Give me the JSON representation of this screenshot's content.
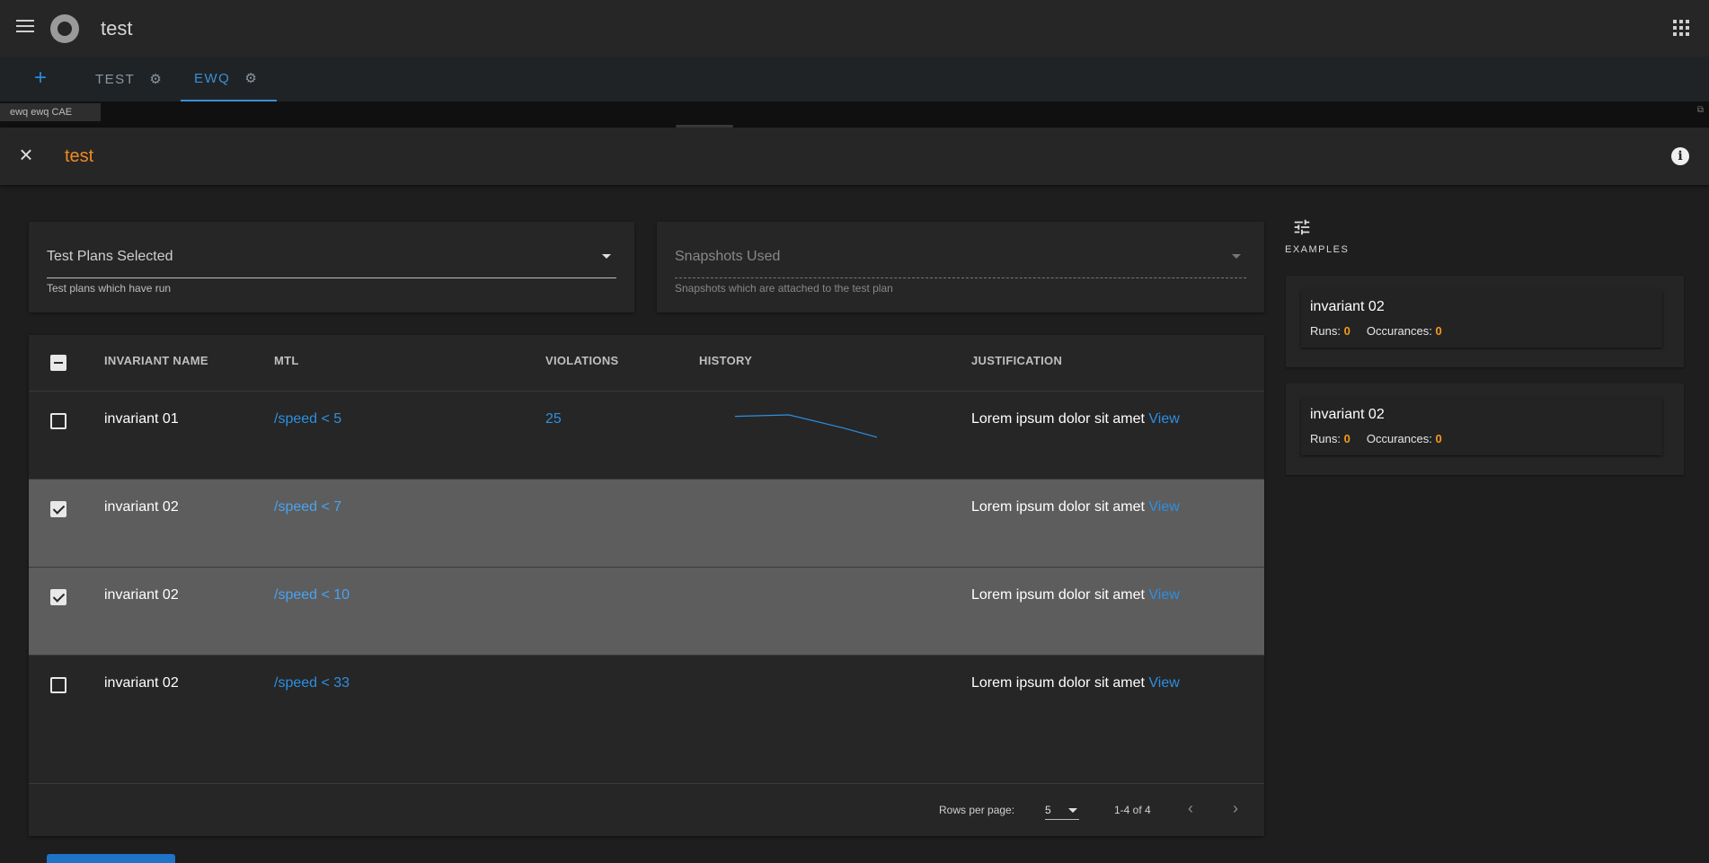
{
  "app": {
    "title": "test"
  },
  "tabs": [
    {
      "label": "TEST",
      "active": false
    },
    {
      "label": "EWQ",
      "active": true
    }
  ],
  "tab_add_label": "+",
  "substrip": {
    "chip_label": "ewq ewq CAE"
  },
  "dialog": {
    "title": "test"
  },
  "filters": {
    "test_plans": {
      "label": "Test Plans Selected",
      "helper": "Test plans which have run"
    },
    "snapshots": {
      "label": "Snapshots Used",
      "helper": "Snapshots which are attached to the test plan"
    }
  },
  "table": {
    "headers": {
      "name": "INVARIANT NAME",
      "mtl": "MTL",
      "violations": "VIOLATIONS",
      "history": "HISTORY",
      "justification": "JUSTIFICATION"
    },
    "rows": [
      {
        "name": "invariant 01",
        "mtl": "/speed < 5",
        "violations": "25",
        "history": [
          0.95,
          1.0,
          0.55,
          0.0
        ],
        "justification": "Lorem ipsum dolor sit amet",
        "view": "View",
        "checked": false
      },
      {
        "name": "invariant 02",
        "mtl": "/speed < 7",
        "violations": "",
        "justification": "Lorem ipsum dolor sit amet",
        "view": "View",
        "checked": true
      },
      {
        "name": "invariant 02",
        "mtl": "/speed < 10",
        "violations": "",
        "justification": "Lorem ipsum dolor sit amet",
        "view": "View",
        "checked": true
      },
      {
        "name": "invariant 02",
        "mtl": "/speed < 33",
        "violations": "",
        "justification": "Lorem ipsum dolor sit amet",
        "view": "View",
        "checked": false
      }
    ],
    "footer": {
      "rows_label": "Rows per page:",
      "rows_value": "5",
      "range": "1-4 of 4"
    }
  },
  "examples": {
    "label": "EXAMPLES",
    "items": [
      {
        "title": "invariant 02",
        "runs_label": "Runs:",
        "runs": "0",
        "occ_label": "Occurances:",
        "occ": "0"
      },
      {
        "title": "invariant 02",
        "runs_label": "Runs:",
        "runs": "0",
        "occ_label": "Occurances:",
        "occ": "0"
      }
    ]
  },
  "colors": {
    "accent": "#2e8fe0",
    "title_orange": "#f08a24",
    "stat_orange": "#f49b1f",
    "selected_row": "#5d5d5d"
  }
}
